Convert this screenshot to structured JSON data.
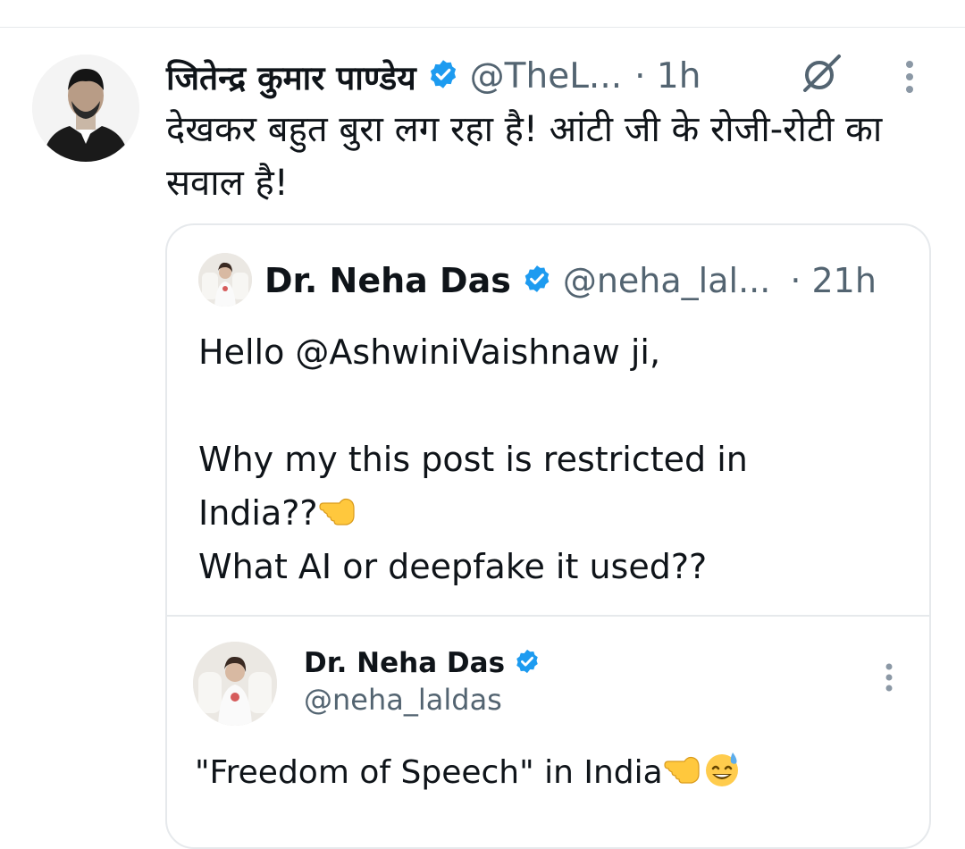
{
  "tweet": {
    "author_name": "जितेन्द्र कुमार पाण्डेय",
    "handle": "@TheL...",
    "time": "· 1h",
    "text": "देखकर बहुत बुरा लग रहा है! आंटी जी के रोजी-रोटी का सवाल है!",
    "verified": true
  },
  "quoted": {
    "author_name": "Dr. Neha Das",
    "handle": "@neha_lal...",
    "time": "· 21h",
    "lines": [
      "Hello @AshwiniVaishnaw ji,",
      "",
      "Why my this post is restricted in",
      "India??",
      "What AI or deepfake it used??"
    ],
    "verified": true
  },
  "embedded": {
    "author_name": "Dr. Neha Das",
    "handle": "@neha_laldas",
    "text": "\"Freedom of Speech\" in India",
    "verified": true
  },
  "icons": {
    "verified": "verified-badge-icon",
    "grok": "grok-icon",
    "more": "more-vertical-icon",
    "pointing": "backhand-index-pointing-left-emoji",
    "sweat_smile": "grinning-face-with-sweat-emoji"
  },
  "colors": {
    "text": "#0f1419",
    "secondary": "#536471",
    "verified": "#1d9bf0",
    "border": "#e6e9ec"
  }
}
